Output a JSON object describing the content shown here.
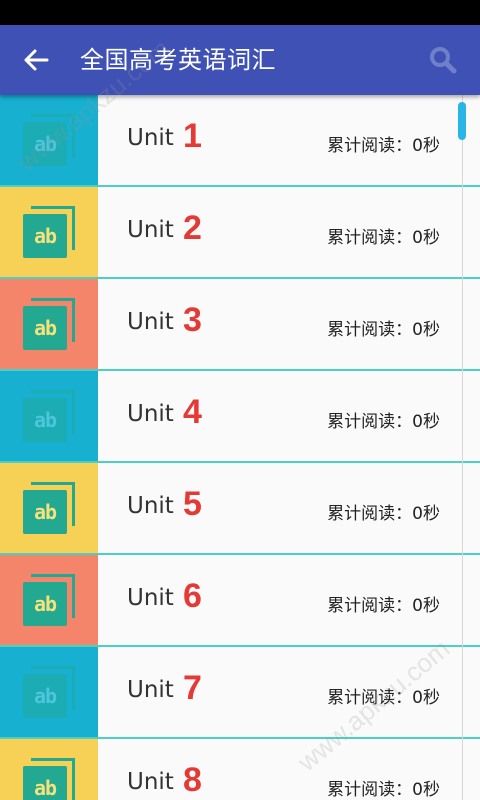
{
  "app_bar": {
    "title": "全国高考英语词汇",
    "back_icon": "arrow-left-icon",
    "search_icon": "search-icon",
    "color": "#3f51b5"
  },
  "list": {
    "unit_word": "Unit",
    "items": [
      {
        "number": "1",
        "tile": "blue",
        "read": "累计阅读：0秒"
      },
      {
        "number": "2",
        "tile": "yellow",
        "read": "累计阅读：0秒"
      },
      {
        "number": "3",
        "tile": "orange",
        "read": "累计阅读：0秒"
      },
      {
        "number": "4",
        "tile": "blue",
        "read": "累计阅读：0秒"
      },
      {
        "number": "5",
        "tile": "yellow",
        "read": "累计阅读：0秒"
      },
      {
        "number": "6",
        "tile": "orange",
        "read": "累计阅读：0秒"
      },
      {
        "number": "7",
        "tile": "blue",
        "read": "累计阅读：0秒"
      },
      {
        "number": "8",
        "tile": "yellow",
        "read": "累计阅读：0秒"
      }
    ],
    "icon_text": "ab"
  },
  "colors": {
    "tile_blue": "#17b0d1",
    "tile_yellow": "#f7d155",
    "tile_orange": "#f4846a",
    "unit_number": "#e53935",
    "divider": "#4dd0c4"
  },
  "watermarks": [
    "www.apkzu.com",
    "www.apkzu.com"
  ]
}
